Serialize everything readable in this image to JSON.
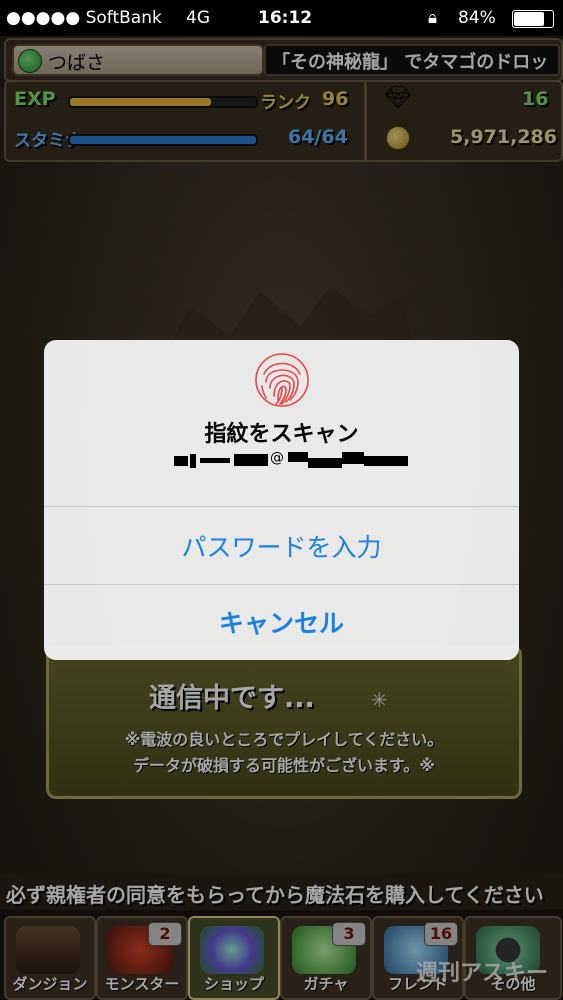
{
  "status_bar": {
    "carrier": "●●●●● SoftBank",
    "network": "4G",
    "time": "16:12",
    "lock_icon": "rotation-lock-icon",
    "battery": "84%",
    "battery_level": 0.84
  },
  "hud": {
    "player_name": "つばさ",
    "ticker": "「その神秘龍」 でタマゴのドロッ",
    "exp_label": "EXP",
    "exp_fraction": 0.76,
    "rank_label": "ランク",
    "rank_value": "96",
    "stamina_label": "スタミナ",
    "stamina_value": "64/64",
    "stamina_fraction": 1.0,
    "stones_value": "16",
    "coins_value": "5,971,286",
    "colors": {
      "exp_bar": "#e6b93a",
      "stamina_bar": "#2f7fd6",
      "green_text": "#7ee36a"
    }
  },
  "comm_dialog": {
    "title": "通信中です...",
    "note_line1": "※電波の良いところでプレイしてください。",
    "note_line2": "データが破損する可能性がございます。※"
  },
  "notice": "必ず親権者の同意をもらってから魔法石を購入してください",
  "tabs": [
    {
      "label": "ダンジョン",
      "badge": ""
    },
    {
      "label": "モンスター",
      "badge": "2"
    },
    {
      "label": "ショップ",
      "badge": ""
    },
    {
      "label": "ガチャ",
      "badge": "3"
    },
    {
      "label": "フレンド",
      "badge": "16"
    },
    {
      "label": "その他",
      "badge": ""
    }
  ],
  "watermark": "週刊アスキー",
  "touchid_alert": {
    "icon": "fingerprint-icon",
    "title": "指紋をスキャン",
    "email_separator": "@",
    "password_button": "パスワードを入力",
    "cancel_button": "キャンセル",
    "accent": "#1a7fe6"
  }
}
